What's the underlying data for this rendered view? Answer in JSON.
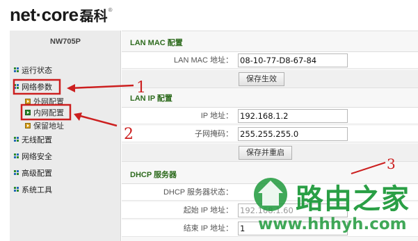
{
  "logo": {
    "text": "net·core",
    "cn": "磊科",
    "reg": "®"
  },
  "sidebar": {
    "model": "NW705P",
    "items": [
      {
        "label": "运行状态"
      },
      {
        "label": "网络参数"
      },
      {
        "label": "无线配置"
      },
      {
        "label": "网络安全"
      },
      {
        "label": "高级配置"
      },
      {
        "label": "系统工具"
      }
    ],
    "subitems": [
      {
        "label": "外网配置"
      },
      {
        "label": "内网配置"
      },
      {
        "label": "保留地址"
      }
    ]
  },
  "lan_mac": {
    "title": "LAN MAC 配置",
    "mac_label": "LAN MAC 地址：",
    "mac_value": "08-10-77-D8-67-84",
    "save_button": "保存生效"
  },
  "lan_ip": {
    "title": "LAN IP 配置",
    "ip_label": "IP 地址：",
    "ip_value": "192.168.1.2",
    "mask_label": "子网掩码：",
    "mask_value": "255.255.255.0",
    "save_button": "保存并重启"
  },
  "dhcp": {
    "title": "DHCP 服务器",
    "status_label": "DHCP 服务器状态：",
    "start_label": "起始 IP 地址：",
    "start_value": "192.168.1.60",
    "end_label": "结束 IP 地址：",
    "end_value": "1"
  },
  "annotations": {
    "marker1": "1",
    "marker2": "2",
    "marker3": "3",
    "color": "#cc1f1f"
  },
  "watermark": {
    "brand": "路由之家",
    "url": "www.hhhyh.com",
    "color": "#1f9a3c"
  }
}
